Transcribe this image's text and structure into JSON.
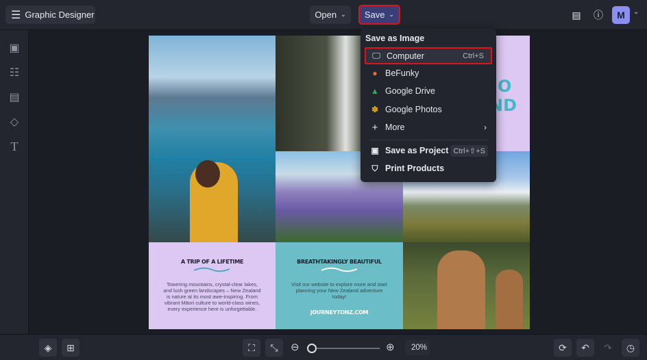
{
  "header": {
    "title": "Graphic Designer",
    "open_label": "Open",
    "save_label": "Save",
    "avatar_initial": "M"
  },
  "save_menu": {
    "section_title": "Save as Image",
    "items": [
      {
        "label": "Computer",
        "shortcut": "Ctrl+S",
        "icon": "monitor-icon"
      },
      {
        "label": "BeFunky",
        "icon": "befunky-icon"
      },
      {
        "label": "Google Drive",
        "icon": "google-drive-icon"
      },
      {
        "label": "Google Photos",
        "icon": "google-photos-icon"
      },
      {
        "label": "More",
        "icon": "plus-icon"
      },
      {
        "label": "Save as Project",
        "shortcut": "Ctrl+⇧+S",
        "icon": "briefcase-icon"
      },
      {
        "label": "Print Products",
        "icon": "tshirt-icon"
      }
    ]
  },
  "collage": {
    "card1": {
      "title": "A TRIP OF A LIFETIME",
      "body": "Towering mountains, crystal-clear lakes, and lush green landscapes – New Zealand is nature at its most awe-inspiring. From vibrant Māori culture to world-class wines, every experience here is unforgettable."
    },
    "card2": {
      "title": "BREATHTAKINGLY BEAUTIFUL",
      "body": "Visit our website to explore more and start planning your New Zealand adventure today!",
      "link": "JOURNEYTONZ.COM"
    },
    "partial_title": [
      "O",
      "ND"
    ]
  },
  "zoom": {
    "value": "20%",
    "fraction": 0.05
  },
  "colors": {
    "accent_highlight": "#e0131b",
    "lavender": "#dcc8f2",
    "teal": "#6bbdc8"
  }
}
